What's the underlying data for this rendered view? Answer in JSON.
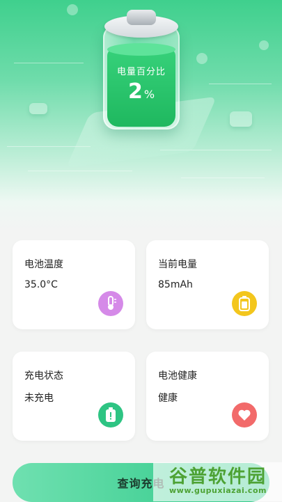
{
  "hero": {
    "charge_label": "电量百分比",
    "charge_value": "2",
    "charge_unit": "%"
  },
  "cards": [
    {
      "title": "电池温度",
      "value": "35.0°C",
      "icon": "thermometer-icon",
      "icon_color": "#d58ae8"
    },
    {
      "title": "当前电量",
      "value": "85mAh",
      "icon": "battery-icon",
      "icon_color": "#f3c61d"
    },
    {
      "title": "充电状态",
      "value": "未充电",
      "icon": "battery-alert-icon",
      "icon_color": "#2ec483"
    },
    {
      "title": "电池健康",
      "value": "健康",
      "icon": "heart-icon",
      "icon_color": "#f26a6a"
    }
  ],
  "bottom_button": {
    "label": "查询充电"
  },
  "watermark": {
    "brand": "谷普软件园",
    "url": "www.gupuxiazai.com"
  },
  "colors": {
    "accent": "#2cc887",
    "background": "#f3f4f3"
  }
}
